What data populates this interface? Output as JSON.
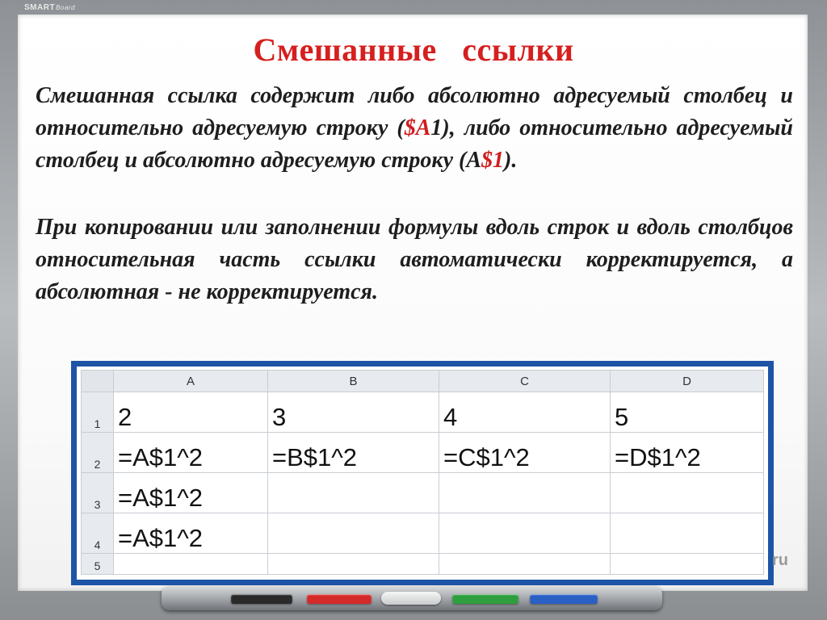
{
  "board": {
    "brand": "SMART",
    "brand_sub": "Board",
    "watermark": "ru"
  },
  "slide": {
    "title": "Смешанные   ссылки",
    "paragraph1": {
      "part1": "Смешанная ссылка содержит либо абсолютно адресуемый столбец и относительно адресуемую строку (",
      "ref1": "$A",
      "part2": "1), либо относительно адресуемый столбец и абсолютно адресуемую строку (А",
      "ref2": "$1",
      "part3": ")."
    },
    "paragraph2": "При копировании или заполнении формулы вдоль строк и вдоль столбцов относительная часть ссылки автоматически корректируется, а абсолютная - не корректируется."
  },
  "spreadsheet": {
    "columns": [
      "A",
      "B",
      "C",
      "D"
    ],
    "row_numbers": [
      "1",
      "2",
      "3",
      "4",
      "5"
    ],
    "rows": [
      [
        "2",
        "3",
        "4",
        "5"
      ],
      [
        "=A$1^2",
        "=B$1^2",
        "=C$1^2",
        "=D$1^2"
      ],
      [
        "=A$1^2",
        "",
        "",
        ""
      ],
      [
        "=A$1^2",
        "",
        "",
        ""
      ],
      [
        "",
        "",
        "",
        ""
      ]
    ]
  },
  "colors": {
    "title": "#d61f1f",
    "reference_highlight": "#cf1d1d",
    "sheet_border": "#1d54a6",
    "pen_black": "#2a2a2a",
    "pen_red": "#d42a2a",
    "pen_green": "#2e9e3e",
    "pen_blue": "#2a5fc4"
  }
}
